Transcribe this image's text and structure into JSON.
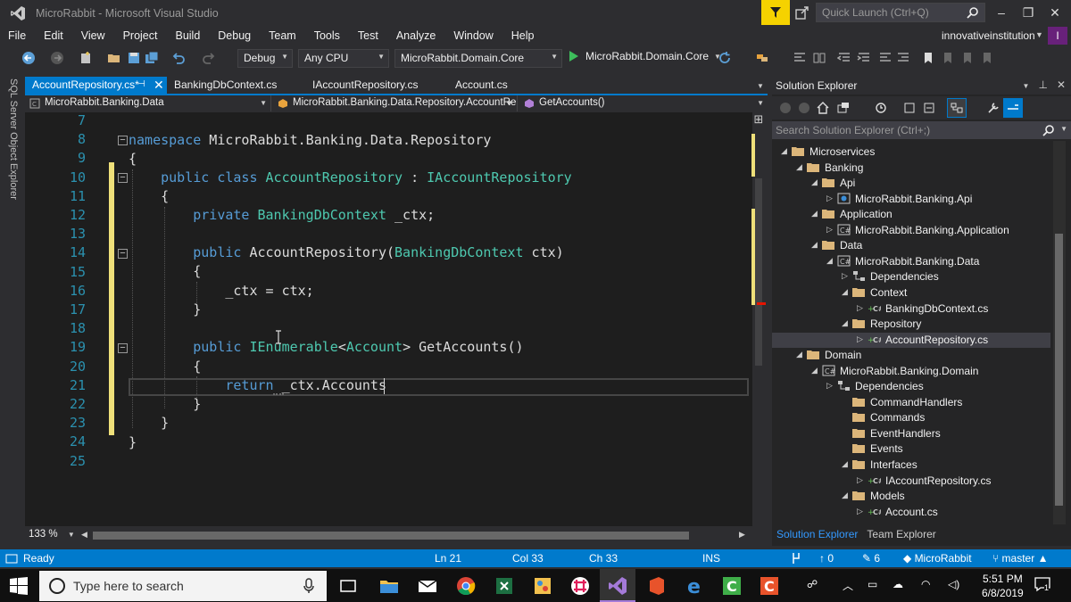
{
  "window": {
    "title": "MicroRabbit - Microsoft Visual Studio",
    "quick_launch_placeholder": "Quick Launch (Ctrl+Q)",
    "account_name": "innovativeinstitution",
    "avatar_letter": "I"
  },
  "menu": [
    "File",
    "Edit",
    "View",
    "Project",
    "Build",
    "Debug",
    "Team",
    "Tools",
    "Test",
    "Analyze",
    "Window",
    "Help"
  ],
  "toolbar": {
    "configuration": "Debug",
    "platform": "Any CPU",
    "startup_project": "MicroRabbit.Domain.Core",
    "run_label": "MicroRabbit.Domain.Core"
  },
  "left_strip": {
    "label": "SQL Server Object Explorer"
  },
  "tabs": [
    {
      "label": "AccountRepository.cs*",
      "active": true
    },
    {
      "label": "BankingDbContext.cs",
      "active": false
    },
    {
      "label": "IAccountRepository.cs",
      "active": false
    },
    {
      "label": "Account.cs",
      "active": false
    }
  ],
  "navbar": {
    "project": "MicroRabbit.Banking.Data",
    "type": "MicroRabbit.Banking.Data.Repository.AccountRe",
    "member": "GetAccounts()"
  },
  "editor": {
    "line_numbers": [
      "7",
      "8",
      "9",
      "10",
      "11",
      "12",
      "13",
      "14",
      "15",
      "16",
      "17",
      "18",
      "19",
      "20",
      "21",
      "22",
      "23",
      "24",
      "25"
    ],
    "zoom": "133 %"
  },
  "solution_explorer": {
    "title": "Solution Explorer",
    "search_placeholder": "Search Solution Explorer (Ctrl+;)",
    "tree": [
      {
        "label": "Microservices",
        "icon": "folder-icon",
        "expander": "open"
      },
      {
        "label": "Banking",
        "icon": "folder-icon",
        "expander": "open"
      },
      {
        "label": "Api",
        "icon": "folder-icon",
        "expander": "open"
      },
      {
        "label": "MicroRabbit.Banking.Api",
        "icon": "web-project-icon",
        "expander": "closed"
      },
      {
        "label": "Application",
        "icon": "folder-icon",
        "expander": "open"
      },
      {
        "label": "MicroRabbit.Banking.Application",
        "icon": "csharp-project-icon",
        "expander": "closed"
      },
      {
        "label": "Data",
        "icon": "folder-icon",
        "expander": "open"
      },
      {
        "label": "MicroRabbit.Banking.Data",
        "icon": "csharp-project-icon",
        "expander": "open"
      },
      {
        "label": "Dependencies",
        "icon": "dependencies-icon",
        "expander": "closed"
      },
      {
        "label": "Context",
        "icon": "folder-icon",
        "expander": "open"
      },
      {
        "label": "BankingDbContext.cs",
        "icon": "csharp-file-icon",
        "expander": "closed"
      },
      {
        "label": "Repository",
        "icon": "folder-icon",
        "expander": "open"
      },
      {
        "label": "AccountRepository.cs",
        "icon": "csharp-file-icon",
        "expander": "closed",
        "selected": true
      },
      {
        "label": "Domain",
        "icon": "folder-icon",
        "expander": "open"
      },
      {
        "label": "MicroRabbit.Banking.Domain",
        "icon": "csharp-project-icon",
        "expander": "open"
      },
      {
        "label": "Dependencies",
        "icon": "dependencies-icon",
        "expander": "closed"
      },
      {
        "label": "CommandHandlers",
        "icon": "folder-icon",
        "expander": "none"
      },
      {
        "label": "Commands",
        "icon": "folder-icon",
        "expander": "none"
      },
      {
        "label": "EventHandlers",
        "icon": "folder-icon",
        "expander": "none"
      },
      {
        "label": "Events",
        "icon": "folder-icon",
        "expander": "none"
      },
      {
        "label": "Interfaces",
        "icon": "folder-icon",
        "expander": "open"
      },
      {
        "label": "IAccountRepository.cs",
        "icon": "csharp-file-icon",
        "expander": "closed"
      },
      {
        "label": "Models",
        "icon": "folder-icon",
        "expander": "open"
      },
      {
        "label": "Account.cs",
        "icon": "csharp-file-icon",
        "expander": "closed"
      }
    ],
    "bottom_tabs": [
      "Solution Explorer",
      "Team Explorer"
    ]
  },
  "statusbar": {
    "state": "Ready",
    "line": "Ln 21",
    "column": "Col 33",
    "char": "Ch 33",
    "mode": "INS",
    "push_count": "0",
    "changes_count": "6",
    "repo": "MicroRabbit",
    "branch": "master"
  },
  "taskbar": {
    "search_placeholder": "Type here to search",
    "time": "5:51 PM",
    "date": "6/8/2019",
    "notification_count": "1"
  },
  "colors": {
    "accent": "#007acc",
    "keyword": "#569cd6",
    "type": "#4ec9b0",
    "line_number": "#2b91af",
    "change_marker": "#efe07a"
  }
}
